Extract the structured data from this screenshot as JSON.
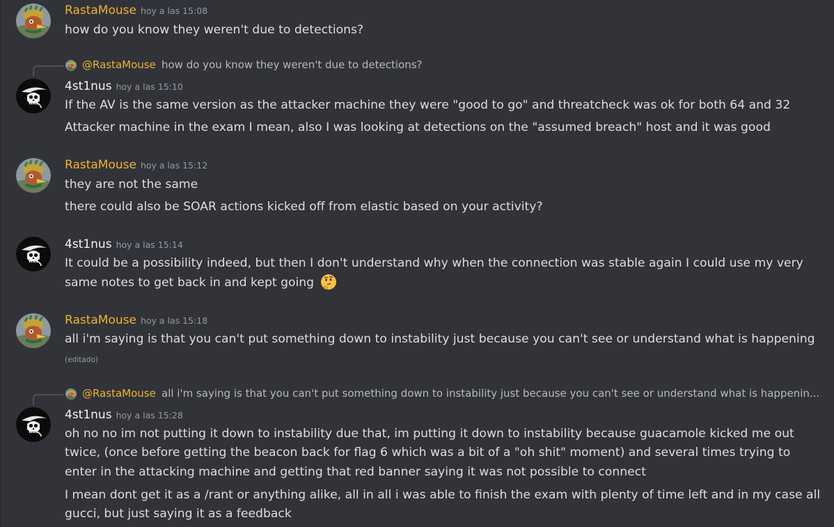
{
  "messages": [
    {
      "author": "RastaMouse",
      "timestamp": "hoy a las 15:08",
      "lines": [
        "how do you know they weren't due to detections?"
      ]
    },
    {
      "reply_to": {
        "author": "@RastaMouse",
        "text": "how do you know they weren't due to detections?"
      },
      "author": "4st1nus",
      "timestamp": "hoy a las 15:10",
      "lines": [
        "If the AV is the same version as the attacker machine they were \"good to go\" and threatcheck was ok for both 64 and 32",
        "Attacker machine in the exam I mean, also I was looking at detections on the \"assumed breach\" host and it was good"
      ]
    },
    {
      "author": "RastaMouse",
      "timestamp": "hoy a las 15:12",
      "lines": [
        "they are not the same",
        "there could also be SOAR actions kicked off from elastic based on your activity?"
      ]
    },
    {
      "author": "4st1nus",
      "timestamp": "hoy a las 15:14",
      "lines": [
        "It could be a possibility indeed, but then I don't understand why when the connection was stable again I could use my very",
        "same notes to get back in and kept going"
      ],
      "emoji": "thinking-face-icon"
    },
    {
      "author": "RastaMouse",
      "timestamp": "hoy a las 15:18",
      "lines": [
        "all i'm saying is that you can't put something down to instability just because you can't see or understand what is happening"
      ],
      "edited": "(editado)"
    },
    {
      "reply_to": {
        "author": "@RastaMouse",
        "text": "all i'm saying is that you can't put something down to instability just because you can't see or understand what is happenin..."
      },
      "author": "4st1nus",
      "timestamp": "hoy a las 15:28",
      "lines": [
        "oh no no im not putting it down to instability due that, im putting it down to instability because guacamole kicked me out",
        "twice, (once before getting the beacon back for flag 6 which was a bit of a \"oh shit\" moment) and several times trying to",
        "enter in the attacking machine and getting that red banner saying it was not possible to connect",
        "I mean dont get it as a /rant or anything alike, all in all i was able to finish the exam with plenty of time left and in my case all",
        "gucci, but just saying it as a feedback"
      ]
    }
  ],
  "colors": {
    "background": "#313338",
    "rasta_name": "#f0b232",
    "user_name": "#f2f3f5",
    "text": "#dbdee1",
    "muted": "#949ba4"
  }
}
